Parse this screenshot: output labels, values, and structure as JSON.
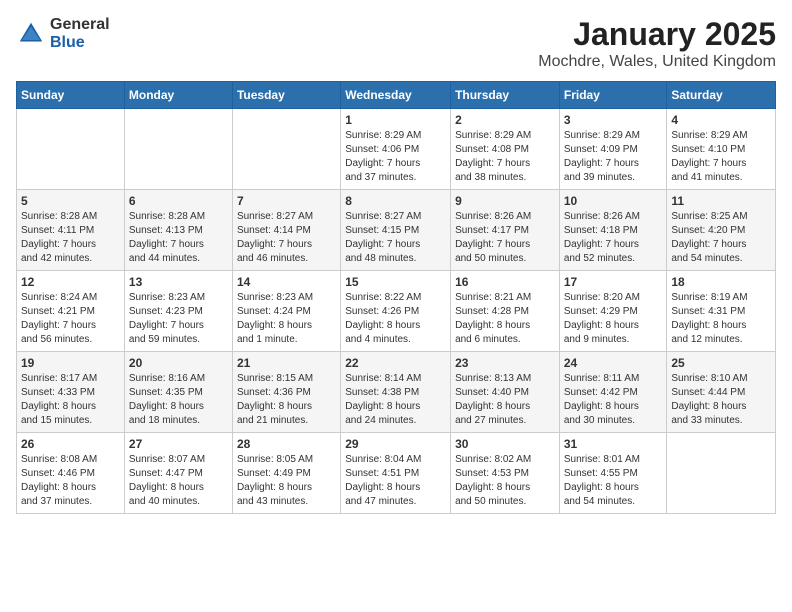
{
  "logo": {
    "general": "General",
    "blue": "Blue"
  },
  "title": "January 2025",
  "location": "Mochdre, Wales, United Kingdom",
  "days_header": [
    "Sunday",
    "Monday",
    "Tuesday",
    "Wednesday",
    "Thursday",
    "Friday",
    "Saturday"
  ],
  "weeks": [
    [
      {
        "day": "",
        "info": ""
      },
      {
        "day": "",
        "info": ""
      },
      {
        "day": "",
        "info": ""
      },
      {
        "day": "1",
        "info": "Sunrise: 8:29 AM\nSunset: 4:06 PM\nDaylight: 7 hours\nand 37 minutes."
      },
      {
        "day": "2",
        "info": "Sunrise: 8:29 AM\nSunset: 4:08 PM\nDaylight: 7 hours\nand 38 minutes."
      },
      {
        "day": "3",
        "info": "Sunrise: 8:29 AM\nSunset: 4:09 PM\nDaylight: 7 hours\nand 39 minutes."
      },
      {
        "day": "4",
        "info": "Sunrise: 8:29 AM\nSunset: 4:10 PM\nDaylight: 7 hours\nand 41 minutes."
      }
    ],
    [
      {
        "day": "5",
        "info": "Sunrise: 8:28 AM\nSunset: 4:11 PM\nDaylight: 7 hours\nand 42 minutes."
      },
      {
        "day": "6",
        "info": "Sunrise: 8:28 AM\nSunset: 4:13 PM\nDaylight: 7 hours\nand 44 minutes."
      },
      {
        "day": "7",
        "info": "Sunrise: 8:27 AM\nSunset: 4:14 PM\nDaylight: 7 hours\nand 46 minutes."
      },
      {
        "day": "8",
        "info": "Sunrise: 8:27 AM\nSunset: 4:15 PM\nDaylight: 7 hours\nand 48 minutes."
      },
      {
        "day": "9",
        "info": "Sunrise: 8:26 AM\nSunset: 4:17 PM\nDaylight: 7 hours\nand 50 minutes."
      },
      {
        "day": "10",
        "info": "Sunrise: 8:26 AM\nSunset: 4:18 PM\nDaylight: 7 hours\nand 52 minutes."
      },
      {
        "day": "11",
        "info": "Sunrise: 8:25 AM\nSunset: 4:20 PM\nDaylight: 7 hours\nand 54 minutes."
      }
    ],
    [
      {
        "day": "12",
        "info": "Sunrise: 8:24 AM\nSunset: 4:21 PM\nDaylight: 7 hours\nand 56 minutes."
      },
      {
        "day": "13",
        "info": "Sunrise: 8:23 AM\nSunset: 4:23 PM\nDaylight: 7 hours\nand 59 minutes."
      },
      {
        "day": "14",
        "info": "Sunrise: 8:23 AM\nSunset: 4:24 PM\nDaylight: 8 hours\nand 1 minute."
      },
      {
        "day": "15",
        "info": "Sunrise: 8:22 AM\nSunset: 4:26 PM\nDaylight: 8 hours\nand 4 minutes."
      },
      {
        "day": "16",
        "info": "Sunrise: 8:21 AM\nSunset: 4:28 PM\nDaylight: 8 hours\nand 6 minutes."
      },
      {
        "day": "17",
        "info": "Sunrise: 8:20 AM\nSunset: 4:29 PM\nDaylight: 8 hours\nand 9 minutes."
      },
      {
        "day": "18",
        "info": "Sunrise: 8:19 AM\nSunset: 4:31 PM\nDaylight: 8 hours\nand 12 minutes."
      }
    ],
    [
      {
        "day": "19",
        "info": "Sunrise: 8:17 AM\nSunset: 4:33 PM\nDaylight: 8 hours\nand 15 minutes."
      },
      {
        "day": "20",
        "info": "Sunrise: 8:16 AM\nSunset: 4:35 PM\nDaylight: 8 hours\nand 18 minutes."
      },
      {
        "day": "21",
        "info": "Sunrise: 8:15 AM\nSunset: 4:36 PM\nDaylight: 8 hours\nand 21 minutes."
      },
      {
        "day": "22",
        "info": "Sunrise: 8:14 AM\nSunset: 4:38 PM\nDaylight: 8 hours\nand 24 minutes."
      },
      {
        "day": "23",
        "info": "Sunrise: 8:13 AM\nSunset: 4:40 PM\nDaylight: 8 hours\nand 27 minutes."
      },
      {
        "day": "24",
        "info": "Sunrise: 8:11 AM\nSunset: 4:42 PM\nDaylight: 8 hours\nand 30 minutes."
      },
      {
        "day": "25",
        "info": "Sunrise: 8:10 AM\nSunset: 4:44 PM\nDaylight: 8 hours\nand 33 minutes."
      }
    ],
    [
      {
        "day": "26",
        "info": "Sunrise: 8:08 AM\nSunset: 4:46 PM\nDaylight: 8 hours\nand 37 minutes."
      },
      {
        "day": "27",
        "info": "Sunrise: 8:07 AM\nSunset: 4:47 PM\nDaylight: 8 hours\nand 40 minutes."
      },
      {
        "day": "28",
        "info": "Sunrise: 8:05 AM\nSunset: 4:49 PM\nDaylight: 8 hours\nand 43 minutes."
      },
      {
        "day": "29",
        "info": "Sunrise: 8:04 AM\nSunset: 4:51 PM\nDaylight: 8 hours\nand 47 minutes."
      },
      {
        "day": "30",
        "info": "Sunrise: 8:02 AM\nSunset: 4:53 PM\nDaylight: 8 hours\nand 50 minutes."
      },
      {
        "day": "31",
        "info": "Sunrise: 8:01 AM\nSunset: 4:55 PM\nDaylight: 8 hours\nand 54 minutes."
      },
      {
        "day": "",
        "info": ""
      }
    ]
  ]
}
